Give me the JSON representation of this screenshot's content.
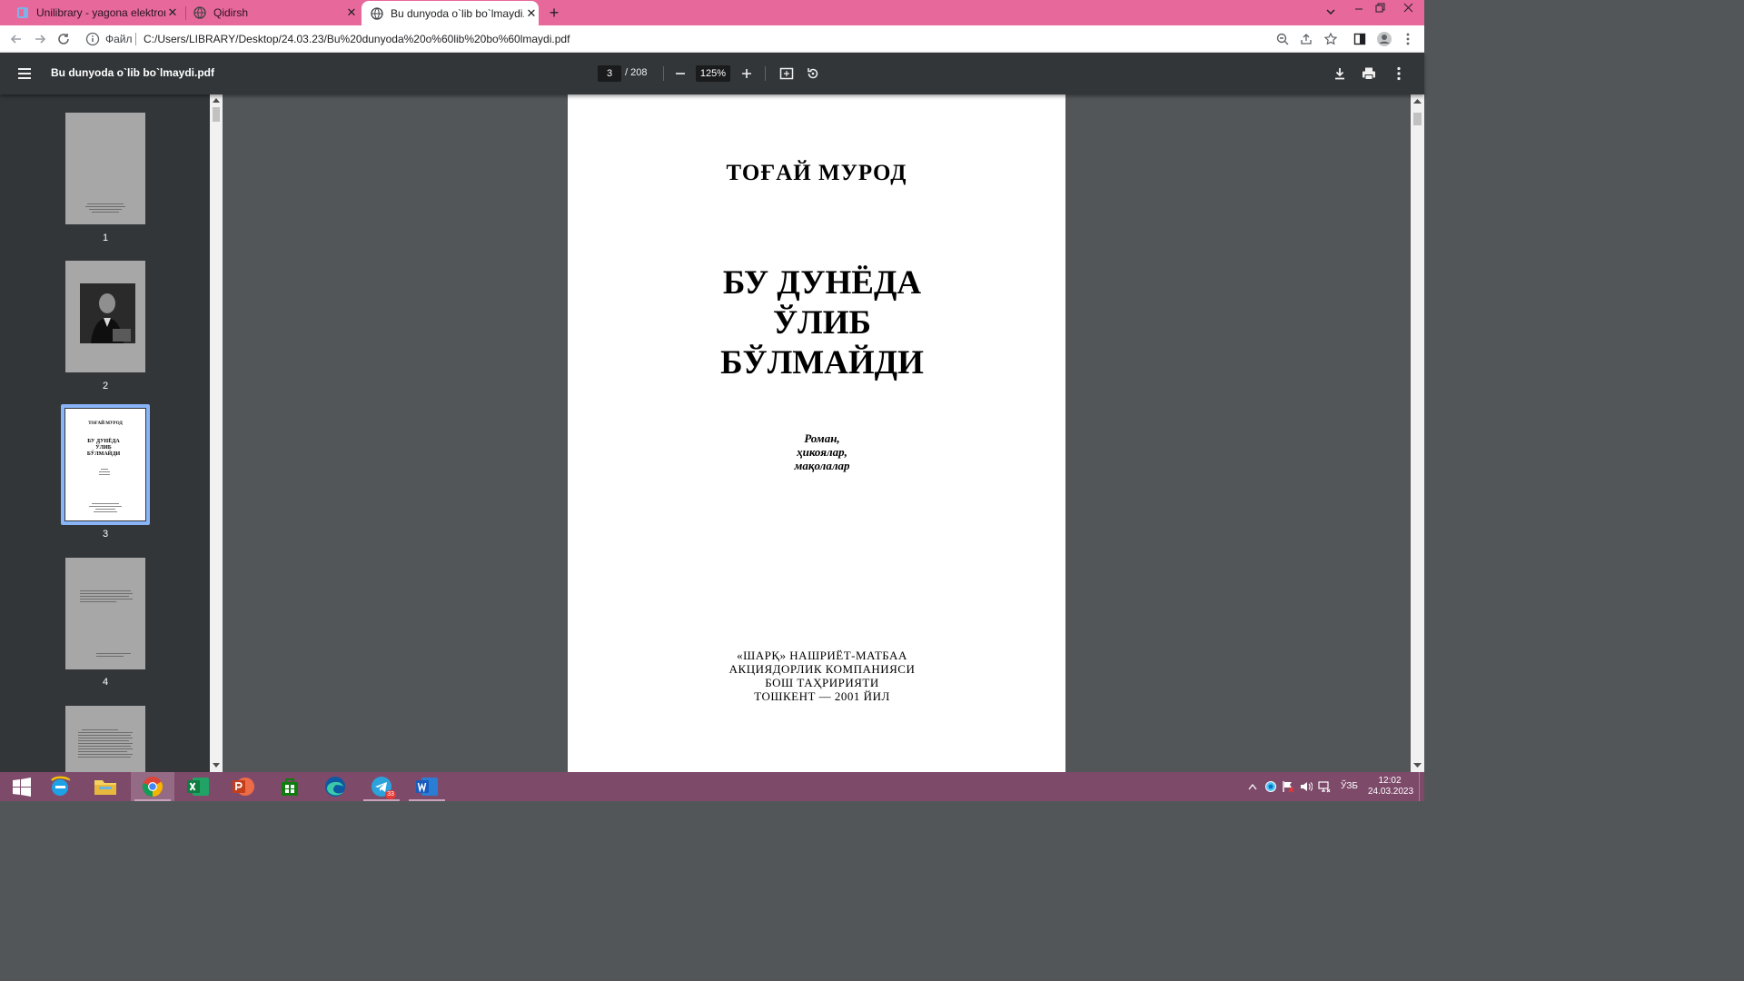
{
  "browser": {
    "tabs": [
      {
        "title": "Unilibrary - yagona elektron kutub",
        "state": "inactive"
      },
      {
        "title": "Qidirsh",
        "state": "inactive"
      },
      {
        "title": "Bu dunyoda o`lib bo`lmaydi.pdf",
        "state": "active"
      }
    ],
    "new_tab": "+",
    "address": {
      "scheme_label": "Файл",
      "url": "C:/Users/LIBRARY/Desktop/24.03.23/Bu%20dunyoda%20o%60lib%20bo%60lmaydi.pdf"
    }
  },
  "pdf_viewer": {
    "title": "Bu dunyoda o`lib bo`lmaydi.pdf",
    "current_page": "3",
    "page_total": "/ 208",
    "zoom": "125%",
    "thumbnails": [
      {
        "num": "1"
      },
      {
        "num": "2"
      },
      {
        "num": "3",
        "selected": true
      },
      {
        "num": "4"
      }
    ]
  },
  "document_page": {
    "author": "ТОҒАЙ МУРОД",
    "title_lines": [
      "БУ ДУНЁДА",
      "ЎЛИБ",
      "БЎЛМАЙДИ"
    ],
    "subtitle_lines": [
      "Роман,",
      "ҳикоялар,",
      "мақолалар"
    ],
    "publisher_lines": [
      "«ШАРҚ» НАШРИЁТ-МАТБАА",
      "АКЦИЯДОРЛИК КОМПАНИЯСИ",
      "БОШ ТАҲРИРИЯТИ",
      "ТОШКЕНТ — 2001 ЙИЛ"
    ],
    "thumb3": {
      "author": "ТОҒАЙ МУРОД",
      "title_lines": [
        "БУ ДУНЁДА",
        "ЎЛИБ",
        "БЎЛМАЙДИ"
      ]
    }
  },
  "taskbar": {
    "apps": [
      "start",
      "internet-explorer",
      "file-explorer",
      "chrome",
      "excel",
      "powerpoint",
      "store",
      "edge",
      "telegram",
      "word"
    ],
    "telegram_badge": "33",
    "language": "ЎЗБ",
    "time": "12:02",
    "date": "24.03.2023"
  },
  "colors": {
    "tabstrip": "#e7689b",
    "pdf_toolbar": "#323639",
    "viewer_bg": "#525659",
    "taskbar": "#7d4a6a",
    "selection": "#8ab4f8"
  }
}
